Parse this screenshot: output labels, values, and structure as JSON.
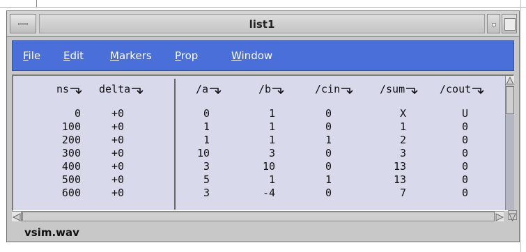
{
  "window": {
    "title": "list1"
  },
  "menu": {
    "items": [
      {
        "first": "F",
        "rest": "ile"
      },
      {
        "first": "E",
        "rest": "dit"
      },
      {
        "first": "M",
        "rest": "arkers"
      },
      {
        "first": "P",
        "rest": "rop"
      },
      {
        "first": "W",
        "rest": "indow"
      }
    ]
  },
  "list": {
    "columns": [
      "ns",
      "delta",
      "/a",
      "/b",
      "/cin",
      "/sum",
      "/cout"
    ],
    "rows": [
      [
        "0",
        "+0",
        "0",
        "1",
        "0",
        "X",
        "U"
      ],
      [
        "100",
        "+0",
        "1",
        "1",
        "0",
        "1",
        "0"
      ],
      [
        "200",
        "+0",
        "1",
        "1",
        "1",
        "2",
        "0"
      ],
      [
        "300",
        "+0",
        "10",
        "3",
        "0",
        "3",
        "0"
      ],
      [
        "400",
        "+0",
        "3",
        "10",
        "0",
        "13",
        "0"
      ],
      [
        "500",
        "+0",
        "5",
        "1",
        "1",
        "13",
        "0"
      ],
      [
        "600",
        "+0",
        "3",
        "-4",
        "0",
        "7",
        "0"
      ]
    ]
  },
  "status": {
    "text": "vsim.wav"
  },
  "colors": {
    "menubar": "#4a6fd8",
    "content_bg": "#d8daec"
  }
}
